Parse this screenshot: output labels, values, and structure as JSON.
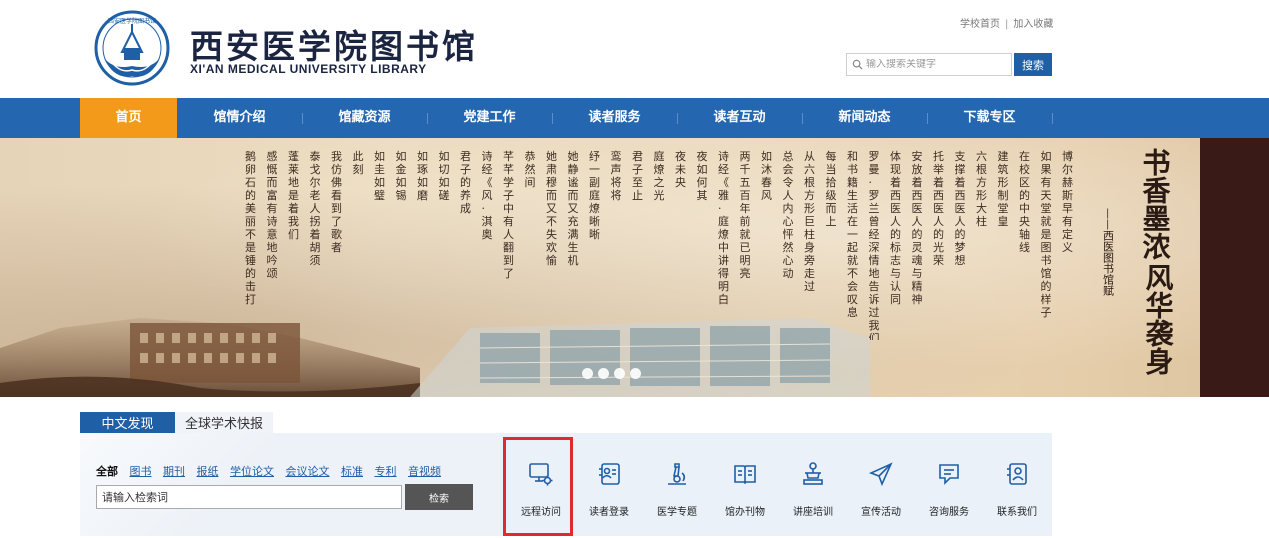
{
  "header": {
    "title_cn": "西安医学院图书馆",
    "title_en": "XI'AN MEDICAL UNIVERSITY LIBRARY",
    "logo_text": "西安医学院图书馆",
    "top_links": [
      "学校首页",
      "加入收藏"
    ],
    "search_placeholder": "输入搜索关键字",
    "search_button": "搜索"
  },
  "nav": {
    "items": [
      "首页",
      "馆情介绍",
      "馆藏资源",
      "党建工作",
      "读者服务",
      "读者互动",
      "新闻动态",
      "下载专区"
    ],
    "active_index": 0
  },
  "banner": {
    "poem_columns": [
      "博尔赫斯早有定义",
      "如果有天堂就是图书馆的样子",
      "在校区的中央轴线",
      "建筑形制堂皇",
      "六根方形大柱",
      "支撑着西医人的梦想",
      "托举着西医人的光荣",
      "安放着西医人的灵魂与精神",
      "体现着西医人的标志与认同",
      "罗曼·罗兰曾经深情地告诉过我们",
      "和书籍生活在一起就不会叹息",
      "每当拾级而上",
      "从六根方形巨柱身旁走过",
      "总会令人内心怦然心动",
      "如沐春风",
      "两千五百年前就已明亮",
      "诗经《小雅·庭燎》中讲得明白",
      "夜如何其",
      "夜未央",
      "庭燎之光",
      "君子至止",
      "鸾声将将",
      "纾一副庭燎晰晰",
      "她静谧而又充满生机",
      "她肃穆而又不失欢愉",
      "恭然间",
      "芊芊学子中有人翻到了",
      "诗经《卫风·淇奥》",
      "君子的养成",
      "如切如磋",
      "如琢如磨",
      "如金如锡",
      "如圭如璧",
      "此刻",
      "我仿佛看到了歌者",
      "泰戈尔老人拐着胡须",
      "蓬莱地是着我们",
      "感慨而富有诗意地吟颂",
      "鹅卵石的美丽不是锤的击打"
    ],
    "calligraphy_top": "书香墨浓",
    "calligraphy_bottom": "风华袭身",
    "calligraphy_sub": "——西医图书馆赋",
    "dots": 4,
    "active_dot": 0
  },
  "search": {
    "tabs": [
      "中文发现",
      "全球学术快报"
    ],
    "active_tab": 0,
    "filters": [
      "全部",
      "图书",
      "期刊",
      "报纸",
      "学位论文",
      "会议论文",
      "标准",
      "专利",
      "音视频"
    ],
    "active_filter": 0,
    "input_value": "请输入检索词",
    "button_label": "检索"
  },
  "services": [
    {
      "label": "远程访问",
      "icon": "remote-access-icon"
    },
    {
      "label": "读者登录",
      "icon": "reader-login-icon"
    },
    {
      "label": "医学专题",
      "icon": "microscope-icon"
    },
    {
      "label": "馆办刊物",
      "icon": "open-book-icon"
    },
    {
      "label": "讲座培训",
      "icon": "lecture-podium-icon"
    },
    {
      "label": "宣传活动",
      "icon": "paper-plane-icon"
    },
    {
      "label": "咨询服务",
      "icon": "chat-bubble-icon"
    },
    {
      "label": "联系我们",
      "icon": "contact-card-icon"
    }
  ],
  "colors": {
    "primary_blue": "#2467b0",
    "nav_active": "#f39a1b",
    "highlight_red": "#e12a2a",
    "icon_blue": "#1f5fa6"
  }
}
